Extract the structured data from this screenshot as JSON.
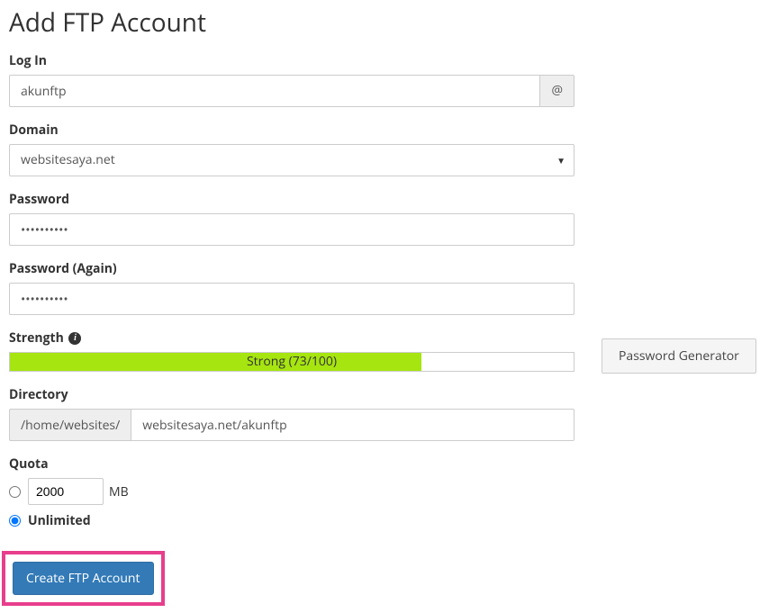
{
  "title": "Add FTP Account",
  "login": {
    "label": "Log In",
    "value": "akunftp",
    "addon": "@"
  },
  "domain": {
    "label": "Domain",
    "value": "websitesaya.net"
  },
  "password": {
    "label": "Password",
    "value": "••••••••••"
  },
  "password_again": {
    "label": "Password (Again)",
    "value": "••••••••••"
  },
  "strength": {
    "label": "Strength",
    "text": "Strong (73/100)",
    "percent": 73
  },
  "directory": {
    "label": "Directory",
    "prefix": "/home/websites/",
    "value": "websitesaya.net/akunftp"
  },
  "quota": {
    "label": "Quota",
    "value": "2000",
    "unit": "MB",
    "unlimited_label": "Unlimited",
    "selected": "unlimited"
  },
  "submit": {
    "label": "Create FTP Account"
  },
  "pwgen": {
    "label": "Password Generator"
  }
}
